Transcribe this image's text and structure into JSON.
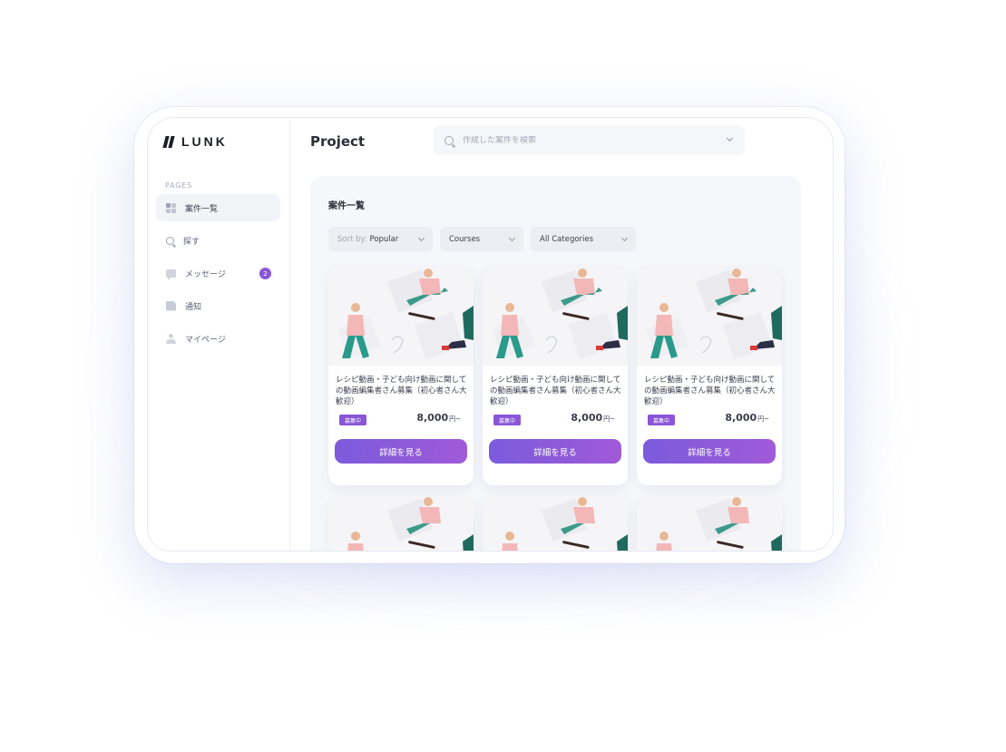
{
  "brand": {
    "name": "LUNK"
  },
  "sidebar": {
    "section_label": "PAGES",
    "items": [
      {
        "label": "案件一覧",
        "icon": "grid-icon",
        "active": true
      },
      {
        "label": "探す",
        "icon": "search-icon"
      },
      {
        "label": "メッセージ",
        "icon": "chat-icon",
        "badge": "2"
      },
      {
        "label": "通知",
        "icon": "document-icon"
      },
      {
        "label": "マイページ",
        "icon": "user-icon"
      }
    ]
  },
  "header": {
    "title": "Project",
    "search_placeholder": "作成した案件を検索"
  },
  "panel": {
    "title": "案件一覧",
    "filters": {
      "sort_prefix": "Sort by:",
      "sort_value": "Popular",
      "courses": "Courses",
      "categories": "All Categories"
    }
  },
  "cards": [
    {
      "title": "レシピ動画・子ども向け動画に関しての動画編集者さん募集（初心者さん大歓迎）",
      "status": "募集中",
      "price": "8,000",
      "unit": "円~",
      "button": "詳細を見る"
    },
    {
      "title": "レシピ動画・子ども向け動画に関しての動画編集者さん募集（初心者さん大歓迎）",
      "status": "募集中",
      "price": "8,000",
      "unit": "円~",
      "button": "詳細を見る"
    },
    {
      "title": "レシピ動画・子ども向け動画に関しての動画編集者さん募集（初心者さん大歓迎）",
      "status": "募集中",
      "price": "8,000",
      "unit": "円~",
      "button": "詳細を見る"
    }
  ],
  "colors": {
    "accent": "#8a55d8",
    "button_gradient_start": "#7b5bdc",
    "button_gradient_end": "#a05ad8"
  }
}
